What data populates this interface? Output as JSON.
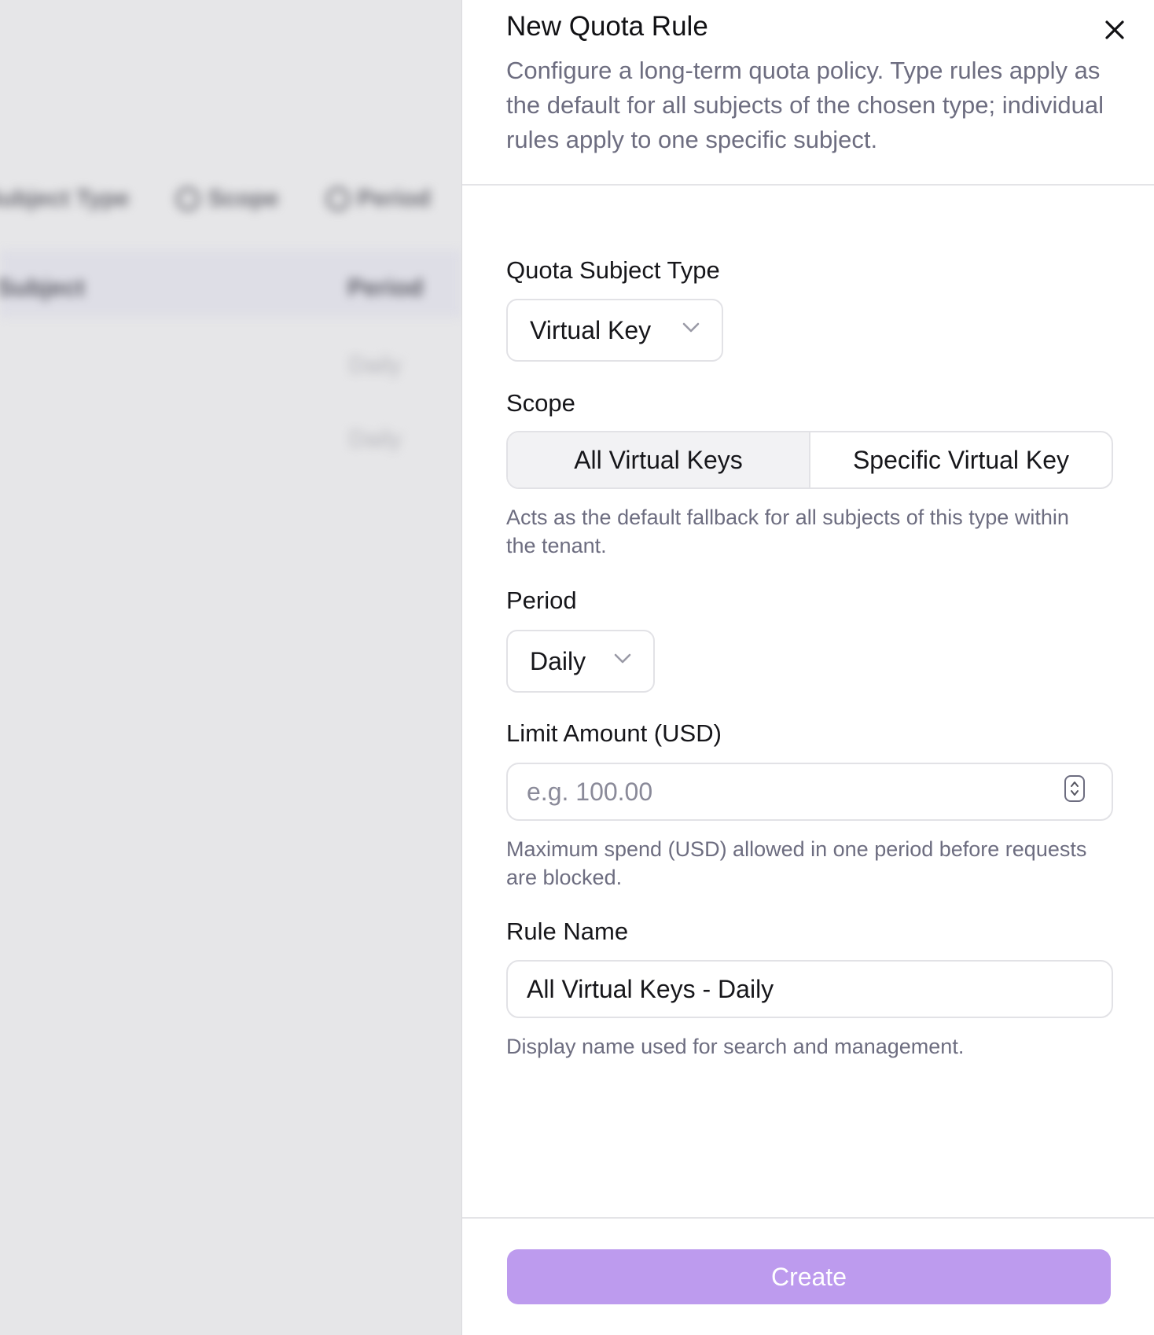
{
  "background": {
    "filters": [
      "Subject Type",
      "Scope",
      "Period"
    ],
    "table_header": {
      "subject": "Subject",
      "period": "Period"
    },
    "rows": [
      "Daily",
      "Daily"
    ]
  },
  "drawer": {
    "title": "New Quota Rule",
    "subtitle": "Configure a long-term quota policy. Type rules apply as the default for all subjects of the chosen type; individual rules apply to one specific subject.",
    "subject_type": {
      "label": "Quota Subject Type",
      "value": "Virtual Key"
    },
    "scope": {
      "label": "Scope",
      "options": [
        "All Virtual Keys",
        "Specific Virtual Key"
      ],
      "selected": "All Virtual Keys",
      "help": "Acts as the default fallback for all subjects of this type within the tenant."
    },
    "period": {
      "label": "Period",
      "value": "Daily"
    },
    "limit": {
      "label": "Limit Amount (USD)",
      "placeholder": "e.g. 100.00",
      "help": "Maximum spend (USD) allowed in one period before requests are blocked."
    },
    "rule_name": {
      "label": "Rule Name",
      "value": "All Virtual Keys - Daily",
      "help": "Display name used for search and management."
    },
    "create_label": "Create",
    "colors": {
      "primary_disabled": "#bd9bee",
      "muted_text": "#6d6d80",
      "border": "#e2e2e6"
    }
  }
}
